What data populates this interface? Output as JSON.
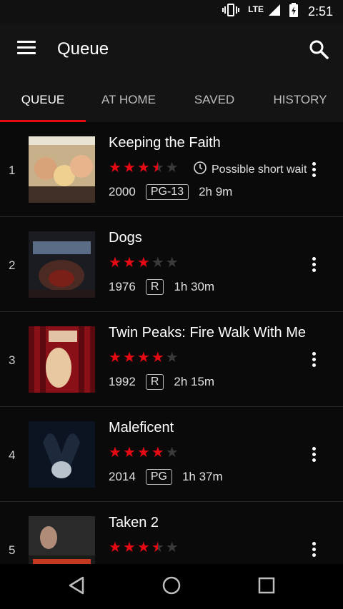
{
  "status": {
    "network": "LTE",
    "time": "2:51"
  },
  "appbar": {
    "title": "Queue"
  },
  "tabs": [
    {
      "label": "QUEUE"
    },
    {
      "label": "AT HOME"
    },
    {
      "label": "SAVED"
    },
    {
      "label": "HISTORY"
    }
  ],
  "items": [
    {
      "index": "1",
      "title": "Keeping the Faith",
      "rating": 3.5,
      "wait": "Possible short wait",
      "year": "2000",
      "mpaa": "PG-13",
      "duration": "2h 9m"
    },
    {
      "index": "2",
      "title": "Dogs",
      "rating": 3,
      "year": "1976",
      "mpaa": "R",
      "duration": "1h 30m"
    },
    {
      "index": "3",
      "title": "Twin Peaks: Fire Walk With Me",
      "rating": 4,
      "year": "1992",
      "mpaa": "R",
      "duration": "2h 15m"
    },
    {
      "index": "4",
      "title": "Maleficent",
      "rating": 4,
      "year": "2014",
      "mpaa": "PG",
      "duration": "1h 37m"
    },
    {
      "index": "5",
      "title": "Taken 2",
      "rating": 3.5
    }
  ],
  "colors": {
    "accent": "#e50914",
    "background": "#0a0a0a",
    "bar": "#141414"
  }
}
